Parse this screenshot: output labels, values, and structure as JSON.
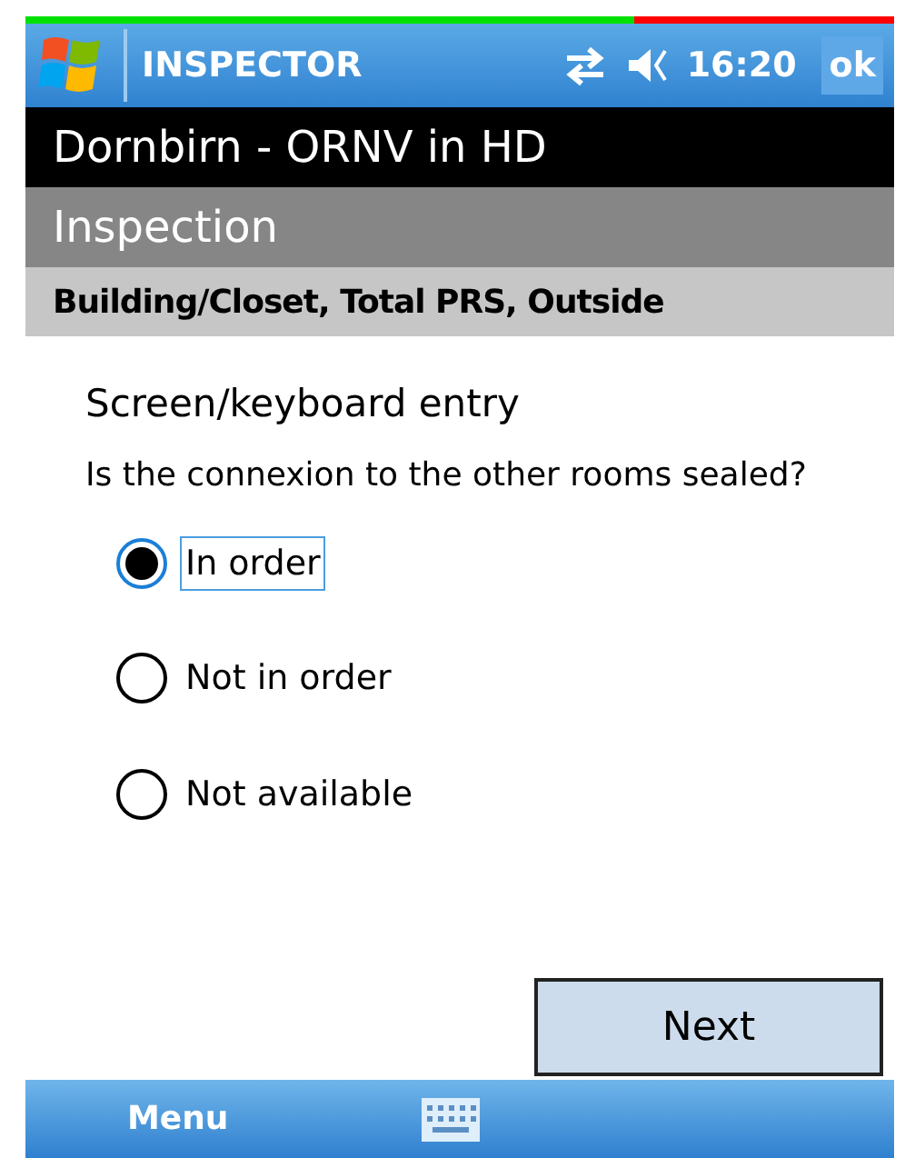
{
  "progress": {
    "level": 0.7
  },
  "title_bar": {
    "title": "INSPECTOR",
    "time": "16:20",
    "ok": "ok"
  },
  "header": "Dornbirn - ORNV in HD",
  "section": "Inspection",
  "location": "Building/Closet, Total PRS, Outside",
  "question": {
    "title": "Screen/keyboard entry",
    "text": "Is the connexion to the other rooms sealed?"
  },
  "options": [
    {
      "label": "In order",
      "selected": true
    },
    {
      "label": "Not in order",
      "selected": false
    },
    {
      "label": "Not available",
      "selected": false
    }
  ],
  "next_button": "Next",
  "menu_bar": {
    "left": "Menu"
  }
}
